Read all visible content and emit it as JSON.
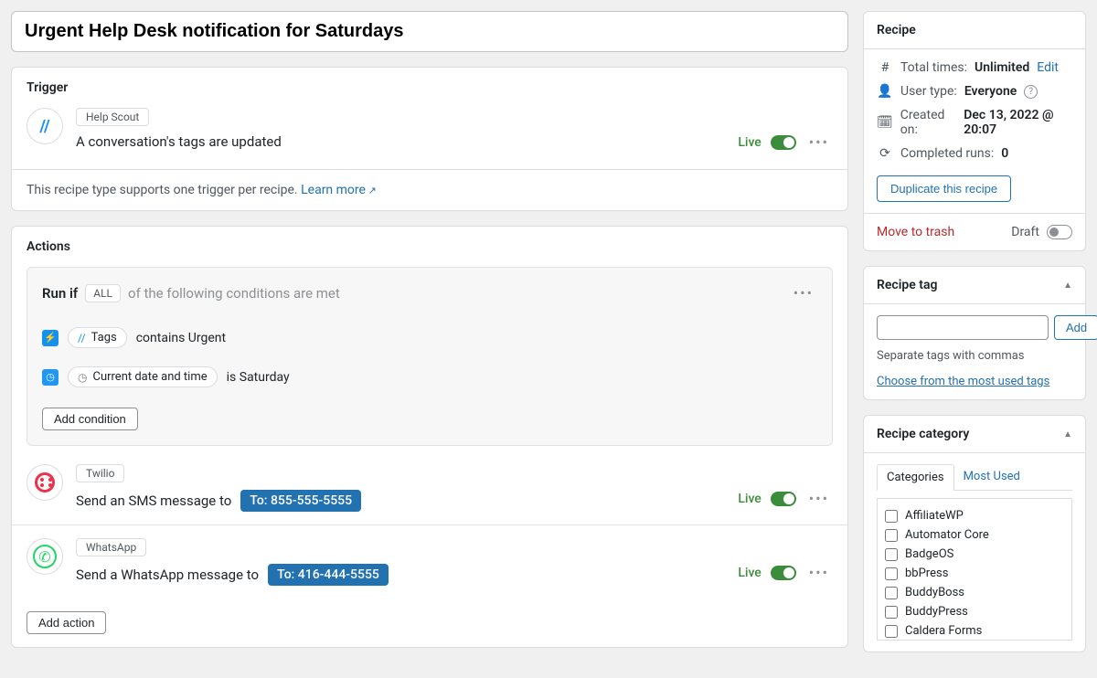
{
  "title": "Urgent Help Desk notification for Saturdays",
  "trigger": {
    "section_label": "Trigger",
    "integration": "Help Scout",
    "text": "A conversation's tags are updated",
    "live_label": "Live",
    "note_text": "This recipe type supports one trigger per recipe. ",
    "note_link": "Learn more"
  },
  "actions": {
    "section_label": "Actions",
    "runif_label": "Run if",
    "all_label": "ALL",
    "runif_tail": "of the following conditions are met",
    "conditions": [
      {
        "pill_label": "Tags",
        "text": "contains Urgent",
        "square": "blue",
        "pill_icon": "hs"
      },
      {
        "pill_label": "Current date and time",
        "text": "is Saturday",
        "square": "blue2",
        "pill_icon": "clock"
      }
    ],
    "add_condition": "Add condition",
    "items": [
      {
        "integration": "Twilio",
        "text": "Send an SMS message to",
        "to": "To: 855-555-5555",
        "live": "Live",
        "icon": "twilio"
      },
      {
        "integration": "WhatsApp",
        "text": "Send a WhatsApp message to",
        "to": "To: 416-444-5555",
        "live": "Live",
        "icon": "whatsapp"
      }
    ],
    "add_action": "Add action"
  },
  "sidebar": {
    "recipe": {
      "title": "Recipe",
      "total_label": "Total times:",
      "total_value": "Unlimited",
      "edit": "Edit",
      "user_label": "User type:",
      "user_value": "Everyone",
      "created_label": "Created on:",
      "created_value": "Dec 13, 2022 @ 20:07",
      "completed_label": "Completed runs:",
      "completed_value": "0",
      "duplicate": "Duplicate this recipe",
      "trash": "Move to trash",
      "draft": "Draft"
    },
    "tag": {
      "title": "Recipe tag",
      "add": "Add",
      "hint": "Separate tags with commas",
      "choose": "Choose from the most used tags"
    },
    "category": {
      "title": "Recipe category",
      "tabs": [
        "Categories",
        "Most Used"
      ],
      "items": [
        "AffiliateWP",
        "Automator Core",
        "BadgeOS",
        "bbPress",
        "BuddyBoss",
        "BuddyPress",
        "Caldera Forms"
      ]
    }
  }
}
